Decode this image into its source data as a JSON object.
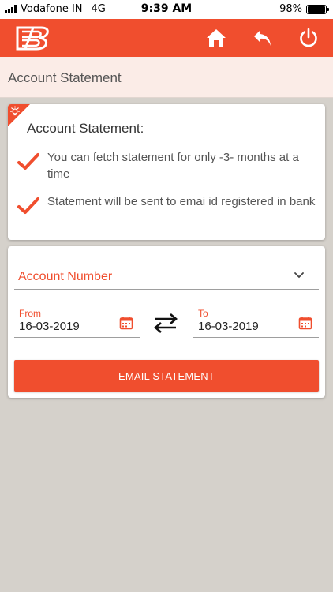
{
  "status_bar": {
    "carrier": "Vodafone IN",
    "network": "4G",
    "time": "9:39 AM",
    "battery_text": "98%",
    "battery_level": 0.98
  },
  "top_bar": {
    "background_color": "#f04e2e",
    "logo": "bank-logo-icon",
    "icons": [
      "home-icon",
      "back-arrow-icon",
      "power-icon"
    ]
  },
  "page": {
    "title": "Account Statement"
  },
  "info_card": {
    "corner_icon": "lightbulb-icon",
    "title": "Account Statement:",
    "notes": [
      "You can fetch statement for only -3- months at a time",
      "Statement will be sent to emai id registered in bank"
    ],
    "note_icon": "checkmark-icon"
  },
  "form": {
    "account_placeholder": "Account Number",
    "from": {
      "label": "From",
      "value": "16-03-2019"
    },
    "to": {
      "label": "To",
      "value": "16-03-2019"
    },
    "swap_icon": "swap-arrows-icon",
    "calendar_icon": "calendar-icon",
    "submit_label": "EMAIL STATEMENT"
  },
  "colors": {
    "accent": "#f04e2e",
    "title_bar_bg": "#fbece7",
    "page_bg": "#d5d1cb"
  }
}
